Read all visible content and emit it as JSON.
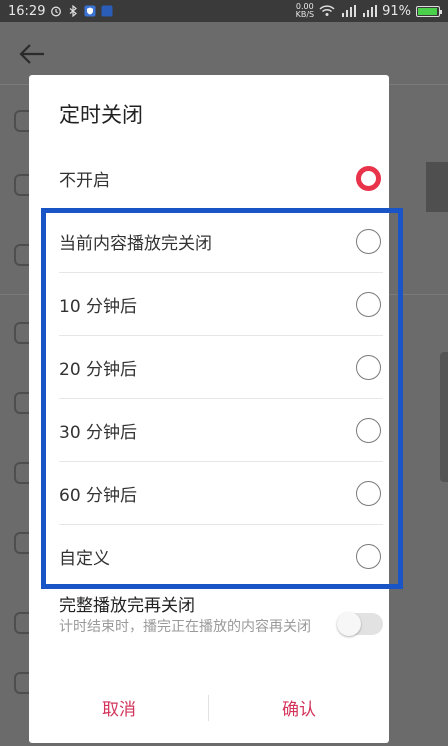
{
  "status_bar": {
    "time": "16:29",
    "net_speed_value": "0.00",
    "net_speed_unit": "KB/S",
    "battery_percent": "91%",
    "battery_level": 0.91
  },
  "dialog": {
    "title": "定时关闭",
    "options": [
      {
        "label": "不开启",
        "checked": true
      },
      {
        "label": "当前内容播放完关闭",
        "checked": false
      },
      {
        "label": "10 分钟后",
        "checked": false
      },
      {
        "label": "20 分钟后",
        "checked": false
      },
      {
        "label": "30 分钟后",
        "checked": false
      },
      {
        "label": "60 分钟后",
        "checked": false
      },
      {
        "label": "自定义",
        "checked": false
      }
    ],
    "full_play": {
      "title": "完整播放完再关闭",
      "description": "计时结束时，播完正在播放的内容再关闭",
      "enabled": false
    },
    "cancel_label": "取消",
    "confirm_label": "确认"
  },
  "colors": {
    "accent": "#e8334a",
    "button_text": "#d3345b",
    "highlight_border": "#1a55c8"
  }
}
